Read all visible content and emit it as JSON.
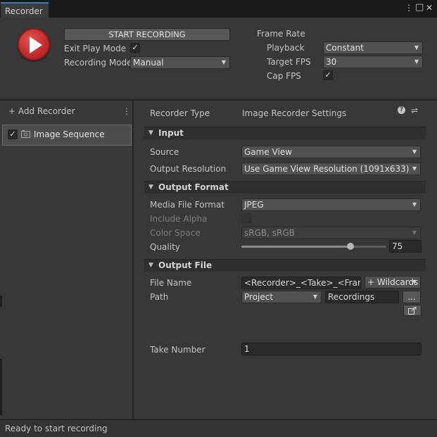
{
  "tab": {
    "title": "Recorder"
  },
  "window_controls": {
    "menu": "⋮",
    "maximize": "□",
    "close": "✕"
  },
  "top": {
    "start_button": "START RECORDING",
    "exit_play_mode_label": "Exit Play Mode",
    "exit_play_mode_checked": "✓",
    "recording_mode_label": "Recording Mode",
    "recording_mode_value": "Manual",
    "frame_rate_label": "Frame Rate",
    "playback_label": "Playback",
    "playback_value": "Constant",
    "target_fps_label": "Target FPS",
    "target_fps_value": "30",
    "cap_fps_label": "Cap FPS",
    "cap_fps_checked": "✓"
  },
  "left": {
    "add_recorder": "+ Add Recorder",
    "more": "⋮",
    "items": [
      {
        "checked": "✓",
        "label": "Image Sequence"
      }
    ]
  },
  "right": {
    "recorder_type_label": "Recorder Type",
    "recorder_type_value": "Image Recorder Settings",
    "help_icon": "?",
    "preset_icon": "⇌",
    "sections": {
      "input": "Input",
      "output_format": "Output Format",
      "output_file": "Output File"
    },
    "source_label": "Source",
    "source_value": "Game View",
    "output_resolution_label": "Output Resolution",
    "output_resolution_value": "Use Game View Resolution (1091x633)",
    "media_file_format_label": "Media File Format",
    "media_file_format_value": "JPEG",
    "include_alpha_label": "Include Alpha",
    "color_space_label": "Color Space",
    "color_space_value": "sRGB, sRGB",
    "quality_label": "Quality",
    "quality_value": "75",
    "quality_fraction": 0.75,
    "file_name_label": "File Name",
    "file_name_value": "<Recorder>_<Take>_<Frame>",
    "wildcards_button": "+ Wildcards",
    "path_label": "Path",
    "path_root_value": "Project",
    "path_value": "Recordings",
    "browse_button": "...",
    "take_number_label": "Take Number",
    "take_number_value": "1"
  },
  "status": {
    "text": "Ready to start recording"
  },
  "colors": {
    "accent": "#3a79bb",
    "record_red": "#c22a2a",
    "background": "#383838"
  }
}
